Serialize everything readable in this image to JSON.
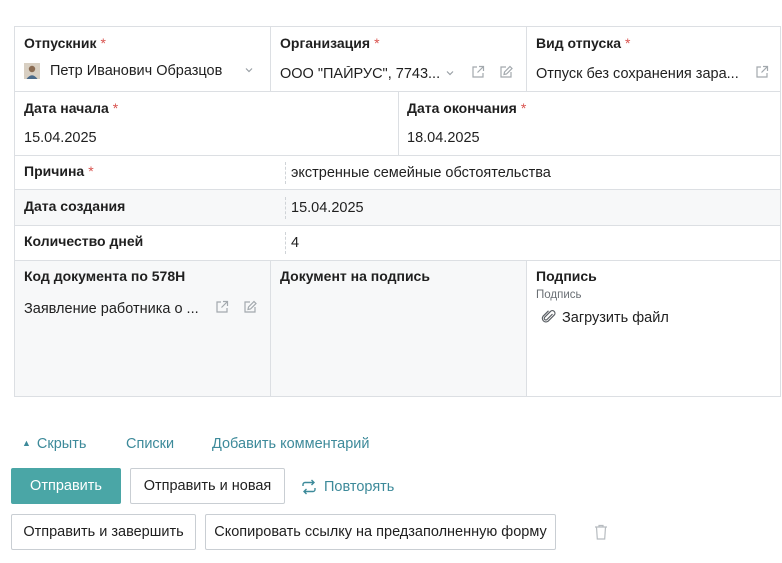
{
  "fields": {
    "employee": {
      "label": "Отпускник",
      "required": "*",
      "value": "Петр Иванович Образцов"
    },
    "organization": {
      "label": "Организация",
      "required": "*",
      "value": "ООО \"ПАЙРУС\", 7743..."
    },
    "leave_type": {
      "label": "Вид отпуска",
      "required": "*",
      "value": "Отпуск без сохранения зара..."
    },
    "start_date": {
      "label": "Дата начала",
      "required": "*",
      "value": "15.04.2025"
    },
    "end_date": {
      "label": "Дата окончания",
      "required": "*",
      "value": "18.04.2025"
    },
    "reason": {
      "label": "Причина",
      "required": "*",
      "value": "экстренные семейные обстоятельства"
    },
    "created_date": {
      "label": "Дата создания",
      "value": "15.04.2025"
    },
    "days_count": {
      "label": "Количество дней",
      "value": "4"
    },
    "doc_code": {
      "label": "Код документа по 578Н",
      "value": "Заявление работника о ..."
    },
    "doc_to_sign": {
      "label": "Документ на подпись"
    },
    "signature": {
      "label": "Подпись",
      "sublabel": "Подпись",
      "upload_label": "Загрузить файл"
    }
  },
  "links": {
    "hide": "Скрыть",
    "lists": "Списки",
    "add_comment": "Добавить комментарий",
    "repeat": "Повторять"
  },
  "buttons": {
    "send": "Отправить",
    "send_and_new": "Отправить и новая",
    "send_and_finish": "Отправить и завершить",
    "copy_link": "Скопировать ссылку на предзаполненную форму"
  },
  "colors": {
    "accent": "#4aa6a6",
    "link": "#3d8a9a",
    "required": "#d9534f",
    "border": "#dcdfe3"
  },
  "icons": {
    "avatar": "user-avatar",
    "open": "external-link-icon",
    "edit": "edit-icon",
    "dropdown": "chevron-down-icon",
    "attach": "paperclip-icon",
    "repeat": "repeat-icon",
    "delete": "trash-icon"
  }
}
